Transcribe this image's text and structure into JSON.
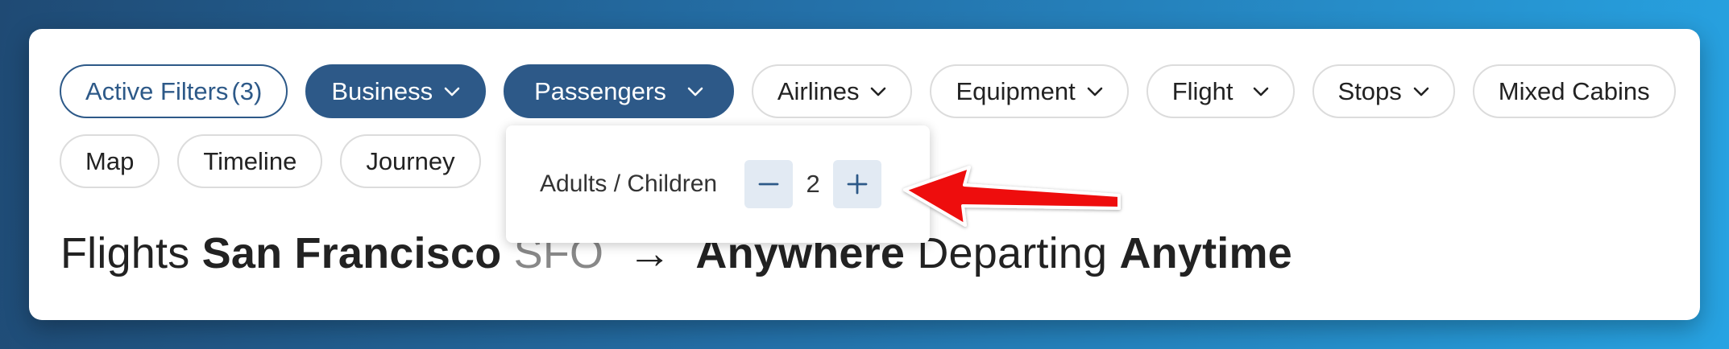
{
  "filters_row1": [
    {
      "label": "Active Filters",
      "count": "(3)",
      "style": "active",
      "chevron": false
    },
    {
      "label": "Business",
      "style": "filled",
      "chevron": true
    },
    {
      "label": "Passengers",
      "style": "filled",
      "chevron": true
    },
    {
      "label": "Airlines",
      "style": "outline",
      "chevron": true
    },
    {
      "label": "Equipment",
      "style": "outline",
      "chevron": true
    },
    {
      "label": "Flight",
      "style": "outline",
      "chevron": true
    },
    {
      "label": "Stops",
      "style": "outline",
      "chevron": true
    },
    {
      "label": "Mixed Cabins",
      "style": "outline",
      "chevron": false
    }
  ],
  "filters_row2": [
    {
      "label": "Map"
    },
    {
      "label": "Timeline"
    },
    {
      "label": "Journey"
    }
  ],
  "passenger_popup": {
    "label": "Adults / Children",
    "count": "2",
    "decrement_icon": "minus-icon",
    "increment_icon": "plus-icon"
  },
  "heading": {
    "prefix": "Flights",
    "origin_city": "San Francisco",
    "origin_code": "SFO",
    "arrow": "→",
    "destination": "Anywhere",
    "departing_label": "Departing",
    "departing_value": "Anytime"
  },
  "annotation": {
    "icon": "red-arrow-icon",
    "color": "#ee1111"
  },
  "colors": {
    "accent": "#2d5988",
    "stepper_bg": "#e2eaf3"
  }
}
